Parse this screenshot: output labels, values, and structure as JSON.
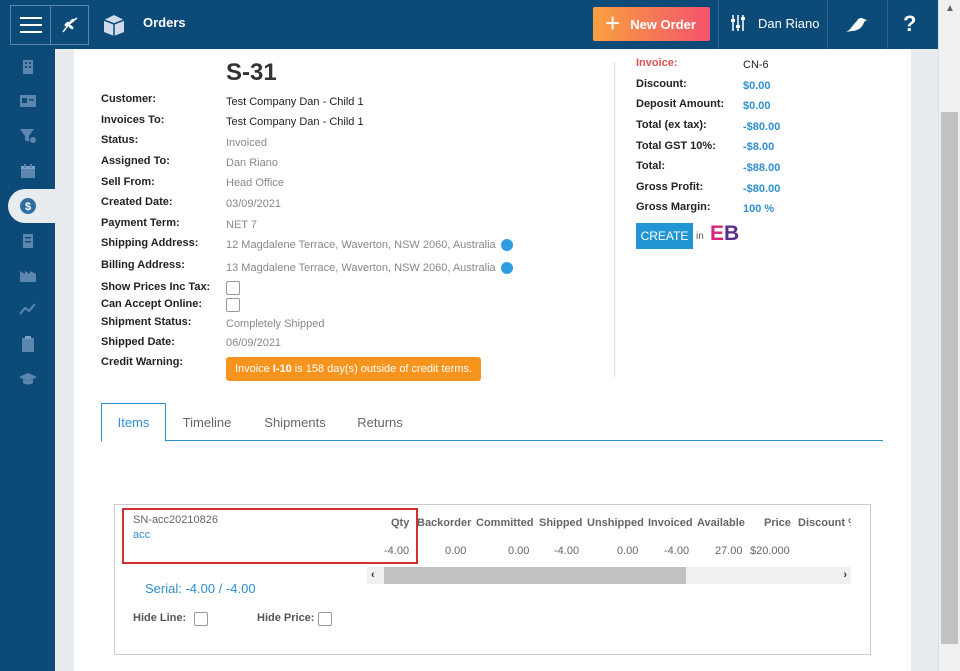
{
  "header": {
    "section_title": "Orders",
    "new_order_label": "New Order",
    "user_name": "Dan Riano",
    "help_label": "?"
  },
  "order": {
    "number": "S-31",
    "fields": [
      {
        "label": "Customer:",
        "value": "Test Company Dan - Child 1"
      },
      {
        "label": "Invoices To:",
        "value": "Test Company Dan - Child 1"
      },
      {
        "label": "Status:",
        "value": "Invoiced"
      },
      {
        "label": "Assigned To:",
        "value": "Dan Riano"
      },
      {
        "label": "Sell From:",
        "value": "Head Office"
      },
      {
        "label": "Created Date:",
        "value": "03/09/2021"
      },
      {
        "label": "Payment Term:",
        "value": "NET 7"
      },
      {
        "label": "Shipping Address:",
        "value": "12 Magdalene Terrace, Waverton, NSW 2060, Australia"
      },
      {
        "label": "Billing Address:",
        "value": "13 Magdalene Terrace, Waverton, NSW 2060, Australia"
      },
      {
        "label": "Show Prices Inc Tax:",
        "value": ""
      },
      {
        "label": "Can Accept Online:",
        "value": ""
      },
      {
        "label": "Shipment Status:",
        "value": "Completely Shipped"
      },
      {
        "label": "Shipped Date:",
        "value": "06/09/2021"
      },
      {
        "label": "Credit Warning:",
        "value": ""
      }
    ],
    "credit_warning": {
      "prefix": "Invoice",
      "invoice": "I-10",
      "suffix": "is 158 day(s) outside of credit terms."
    }
  },
  "summary": {
    "invoice_label": "Invoice:",
    "invoice_value": "CN-6",
    "discount_label": "Discount:",
    "discount_value": "$0.00",
    "deposit_label": "Deposit Amount:",
    "deposit_value": "$0.00",
    "total_ex_label": "Total (ex tax):",
    "total_ex_value": "-$80.00",
    "gst_label": "Total GST 10%:",
    "gst_value": "-$8.00",
    "total_label": "Total:",
    "total_value": "-$88.00",
    "gross_profit_label": "Gross Profit:",
    "gross_profit_value": "-$80.00",
    "gross_margin_label": "Gross Margin:",
    "gross_margin_value": "100 %",
    "create_label": "CREATE",
    "in_label": "in",
    "eb_logo": "EB"
  },
  "tabs": [
    "Items",
    "Timeline",
    "Shipments",
    "Returns"
  ],
  "items_table": {
    "headers": [
      "Qty",
      "Backorder",
      "Committed",
      "Shipped",
      "Unshipped",
      "Invoiced",
      "Available",
      "Price",
      "Discount %"
    ],
    "row": {
      "sku": "SN-acc20210826",
      "name": "acc",
      "values": [
        "-4.00",
        "0.00",
        "0.00",
        "-4.00",
        "0.00",
        "-4.00",
        "27.00",
        "$20.000"
      ]
    },
    "serial": "Serial: -4.00 / -4.00",
    "hide_line_label": "Hide Line:",
    "hide_price_label": "Hide Price:"
  },
  "colors": {
    "brand": "#0c4a78",
    "accent": "#2f8fd0",
    "warning": "#f7941d",
    "highlight": "#d32f2f"
  }
}
